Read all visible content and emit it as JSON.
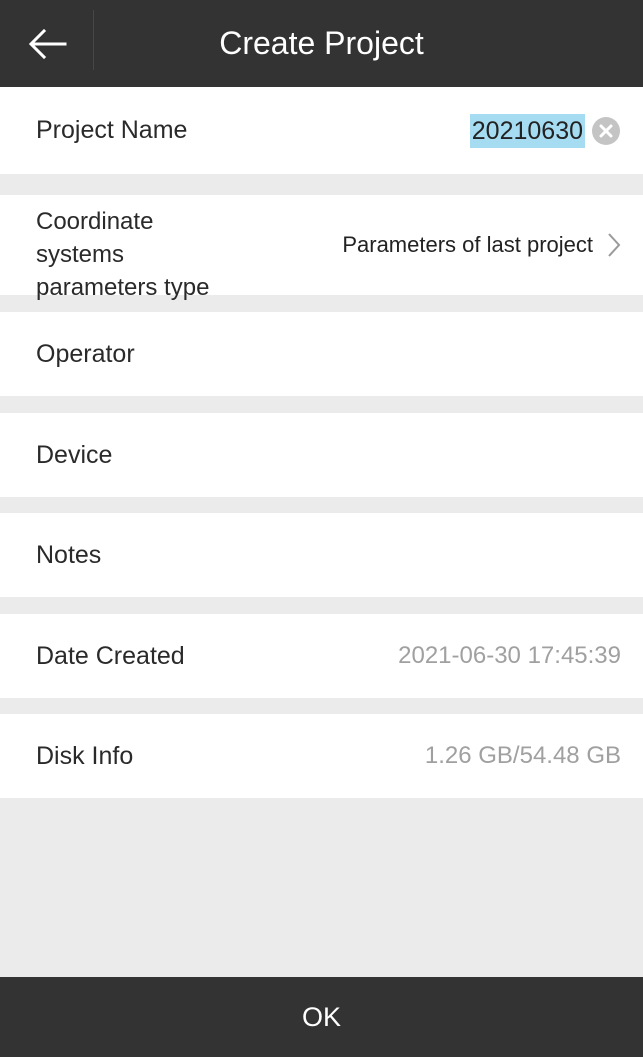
{
  "header": {
    "title": "Create Project",
    "back_icon": "back-arrow-icon"
  },
  "form": {
    "project_name": {
      "label": "Project Name",
      "value": "20210630",
      "clear_icon": "clear-circle-icon"
    },
    "coordinate_params": {
      "label_lines": [
        "Coordinate",
        "systems",
        "parameters type"
      ],
      "value": "Parameters of last project",
      "chevron_icon": "chevron-right-icon"
    },
    "operator": {
      "label": "Operator",
      "value": ""
    },
    "device": {
      "label": "Device",
      "value": ""
    },
    "notes": {
      "label": "Notes",
      "value": ""
    },
    "date_created": {
      "label": "Date Created",
      "value": "2021-06-30 17:45:39"
    },
    "disk_info": {
      "label": "Disk Info",
      "value": "1.26 GB/54.48 GB"
    }
  },
  "footer": {
    "ok_label": "OK"
  },
  "colors": {
    "header_bg": "#333333",
    "page_bg": "#ebebeb",
    "row_bg": "#ffffff",
    "selection_highlight": "#a6dcf2",
    "muted_text": "#a0a0a0"
  }
}
